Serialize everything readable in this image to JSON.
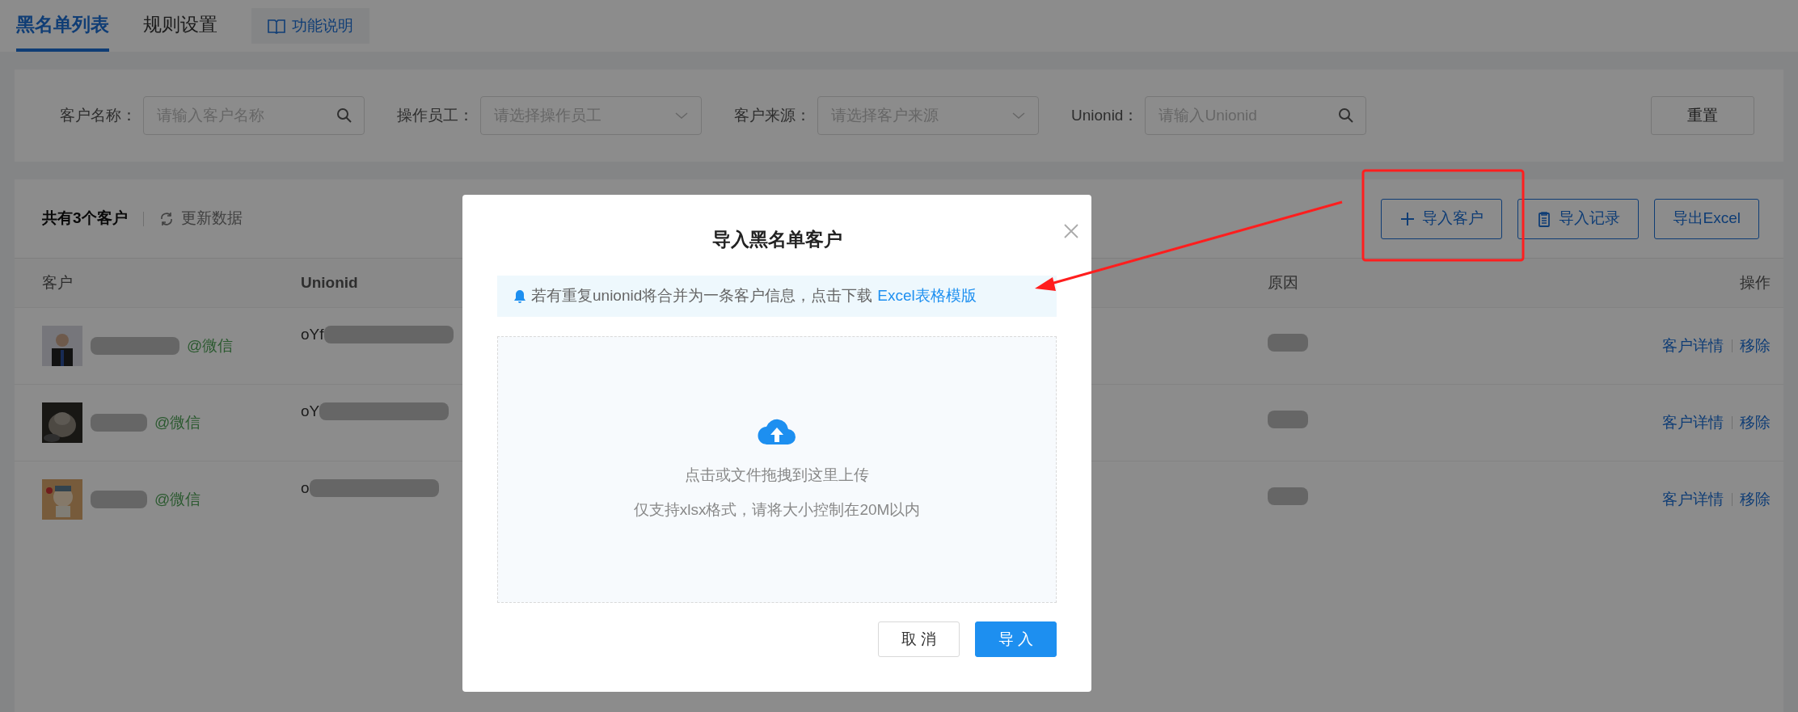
{
  "tabs": [
    {
      "label": "黑名单列表",
      "selected": true
    },
    {
      "label": "规则设置",
      "selected": false
    }
  ],
  "help_button": "功能说明",
  "filters": [
    {
      "label": "客户名称：",
      "placeholder": "请输入客户名称",
      "kind": "search"
    },
    {
      "label": "操作员工：",
      "placeholder": "请选择操作员工",
      "kind": "select"
    },
    {
      "label": "客户来源：",
      "placeholder": "请选择客户来源",
      "kind": "select"
    },
    {
      "label": "Unionid：",
      "placeholder": "请输入Unionid",
      "kind": "search"
    }
  ],
  "reset_button": "重置",
  "summary": {
    "count": "共有3个客户",
    "refresh": "更新数据"
  },
  "toolbar": [
    {
      "label": "导入客户",
      "kind": "plus"
    },
    {
      "label": "导入记录",
      "kind": "clipboard"
    },
    {
      "label": "导出Excel",
      "kind": "plain"
    }
  ],
  "table": {
    "columns": [
      "客户",
      "Unionid",
      "原因",
      "操作"
    ],
    "rows": [
      {
        "source": "@微信",
        "unionid": "oYf",
        "actions": [
          "客户详情",
          "移除"
        ]
      },
      {
        "source": "@微信",
        "unionid": "oY",
        "actions": [
          "客户详情",
          "移除"
        ]
      },
      {
        "source": "@微信",
        "unionid": "o",
        "actions": [
          "客户详情",
          "移除"
        ]
      }
    ]
  },
  "modal": {
    "title": "导入黑名单客户",
    "notice": "若有重复unionid将合并为一条客户信息，点击下载",
    "notice_link": "Excel表格模版",
    "upload_hint": "点击或文件拖拽到这里上传",
    "upload_note": "仅支持xlsx格式，请将大小控制在20M以内",
    "buttons": [
      {
        "label": "取 消",
        "kind": "default"
      },
      {
        "label": "导 入",
        "kind": "primary"
      }
    ]
  }
}
